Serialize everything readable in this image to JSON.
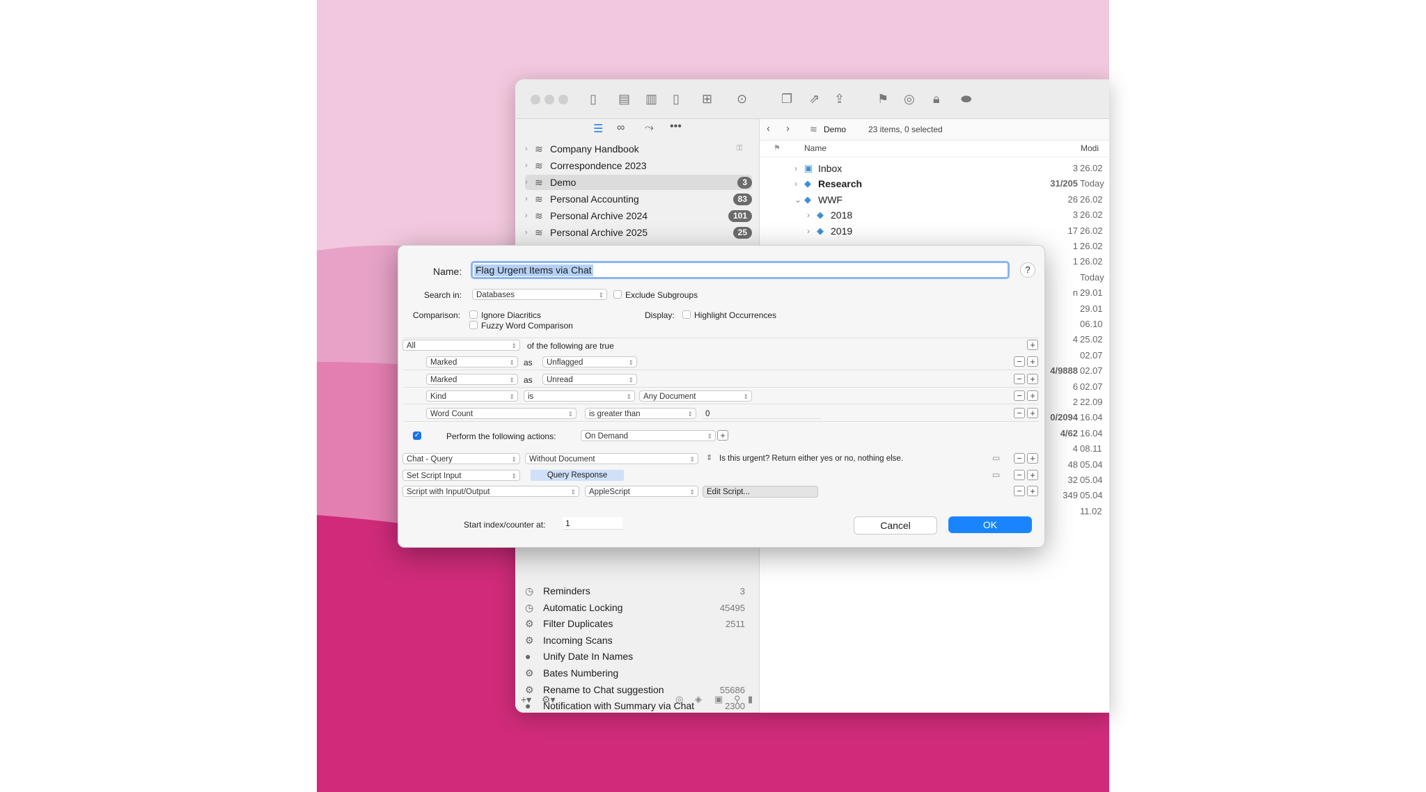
{
  "colors": {
    "accent": "#1a73e8",
    "wall_light": "#f2c8de",
    "wall_mid": "#e68ab8",
    "wall_dark": "#cf2b7a"
  },
  "sidebar": {
    "databases": [
      {
        "label": "Company Handbook",
        "badge": "",
        "icon": "database-stack-icon"
      },
      {
        "label": "Correspondence 2023",
        "badge": "",
        "icon": "database-stack-icon"
      },
      {
        "label": "Demo",
        "badge": "3",
        "icon": "database-stack-icon"
      },
      {
        "label": "Personal Accounting",
        "badge": "83",
        "icon": "database-stack-icon"
      },
      {
        "label": "Personal Archive 2024",
        "badge": "101",
        "icon": "database-stack-icon"
      },
      {
        "label": "Personal Archive 2025",
        "badge": "25",
        "icon": "database-stack-icon"
      }
    ],
    "smart_rules": [
      {
        "label": "Reminders",
        "count": "3",
        "icon": "clock-icon"
      },
      {
        "label": "Automatic Locking",
        "count": "45495",
        "icon": "clock-icon"
      },
      {
        "label": "Filter Duplicates",
        "count": "2511",
        "icon": "gear-icon"
      },
      {
        "label": "Incoming Scans",
        "count": "",
        "icon": "gear-icon"
      },
      {
        "label": "Unify Date In Names",
        "count": "",
        "icon": "circle-icon"
      },
      {
        "label": "Bates Numbering",
        "count": "",
        "icon": "gear-icon"
      },
      {
        "label": "Rename to Chat suggestion",
        "count": "55686",
        "icon": "gear-icon"
      },
      {
        "label": "Notification with Summary via Chat",
        "count": "2300",
        "icon": "circle-icon"
      }
    ]
  },
  "content": {
    "breadcrumb": "Demo",
    "status": "23 items, 0 selected",
    "col_name": "Name",
    "col_modified": "Modi",
    "rows": [
      {
        "name": "Inbox",
        "num": "3",
        "date": "26.02"
      },
      {
        "name": "Research",
        "num": "31/205",
        "date": "Today"
      },
      {
        "name": "WWF",
        "num": "26",
        "date": "26.02"
      },
      {
        "name": "2018",
        "num": "3",
        "date": "26.02"
      },
      {
        "name": "2019",
        "num": "17",
        "date": "26.02"
      }
    ],
    "side_values": [
      {
        "num": "1",
        "date": "26.02"
      },
      {
        "num": "1",
        "date": "26.02"
      },
      {
        "num": "",
        "date": "Today"
      },
      {
        "num": "n",
        "date": "29.01"
      },
      {
        "num": "",
        "date": "29.01"
      },
      {
        "num": "",
        "date": "06.10"
      },
      {
        "num": "4",
        "date": "25.02"
      },
      {
        "num": "",
        "date": "02.07"
      },
      {
        "num": "4/9888",
        "date": "02.07"
      },
      {
        "num": "6",
        "date": "02.07"
      },
      {
        "num": "2",
        "date": "22.09"
      },
      {
        "num": "0/2094",
        "date": "16.04"
      },
      {
        "num": "4/62",
        "date": "16.04"
      },
      {
        "num": "4",
        "date": "08.11"
      },
      {
        "num": "48",
        "date": "05.04"
      },
      {
        "num": "32",
        "date": "05.04"
      },
      {
        "num": "349",
        "date": "05.04"
      },
      {
        "num": "",
        "date": "11.02"
      }
    ]
  },
  "dialog": {
    "name_label": "Name:",
    "name_value": "Flag Urgent Items via Chat",
    "help": "?",
    "search_in_label": "Search in:",
    "search_in_value": "Databases",
    "exclude_subgroups": "Exclude Subgroups",
    "comparison_label": "Comparison:",
    "ignore_diacritics": "Ignore Diacritics",
    "fuzzy": "Fuzzy Word Comparison",
    "display_label": "Display:",
    "highlight": "Highlight Occurrences",
    "all": "All",
    "following": "of the following are true",
    "criteria": [
      {
        "field": "Marked",
        "op": "as",
        "value": "Unflagged"
      },
      {
        "field": "Marked",
        "op": "as",
        "value": "Unread"
      },
      {
        "field": "Kind",
        "op": "is",
        "value": "Any Document"
      },
      {
        "field": "Word Count",
        "op": "is greater than",
        "value": "0"
      }
    ],
    "perform_label": "Perform the following actions:",
    "perform_value": "On Demand",
    "actions": [
      {
        "action": "Chat - Query",
        "param": "Without Document",
        "text": "Is this urgent? Return either yes or no, nothing else."
      },
      {
        "action": "Set Script Input",
        "param": "Query Response"
      },
      {
        "action": "Script with Input/Output",
        "param": "AppleScript",
        "button": "Edit Script..."
      }
    ],
    "counter_label": "Start index/counter at:",
    "counter_value": "1",
    "cancel": "Cancel",
    "ok": "OK"
  }
}
